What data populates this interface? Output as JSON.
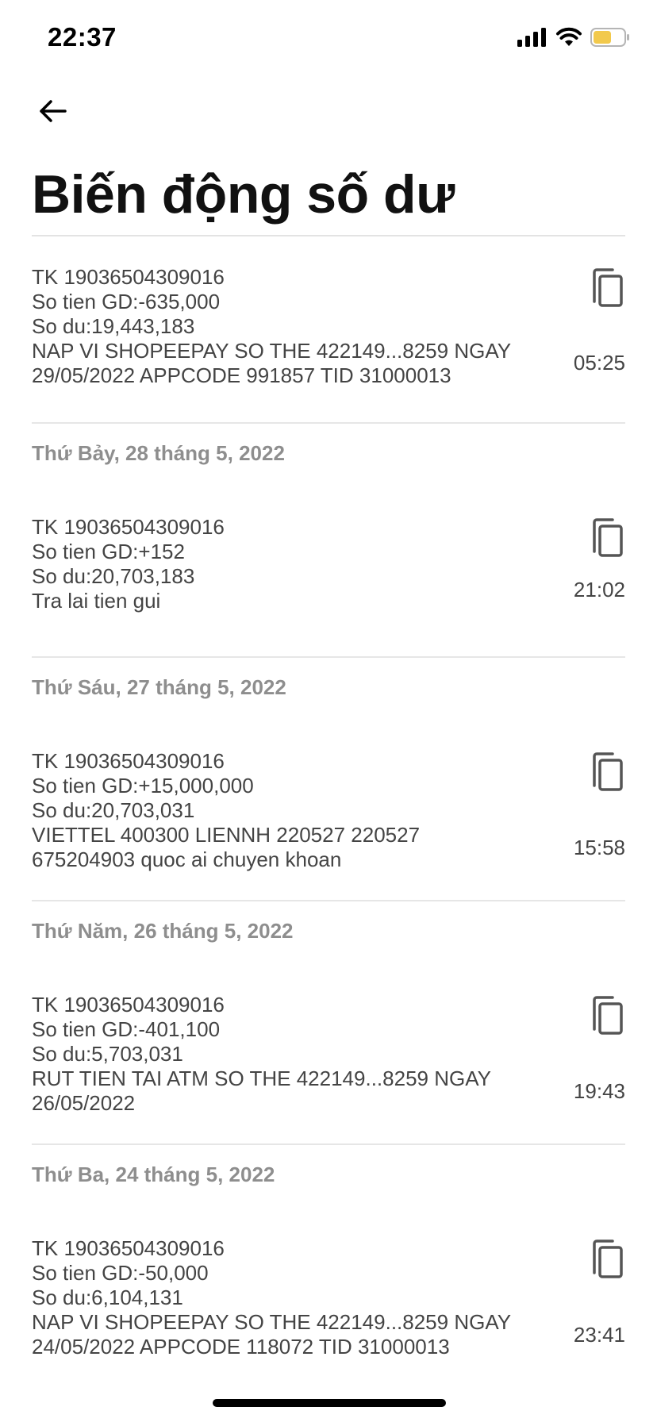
{
  "status_bar": {
    "time": "22:37",
    "battery_color": "#f2c94c"
  },
  "header": {
    "back_icon": "arrow-left-icon",
    "title": "Biến động số dư"
  },
  "groups": [
    {
      "date": "",
      "transactions": [
        {
          "account": "TK 19036504309016",
          "amount": "So tien GD:-635,000",
          "balance": "So du:19,443,183",
          "desc_line1": "NAP VI SHOPEEPAY SO THE 422149...8259 NGAY",
          "desc_line2": "29/05/2022 APPCODE 991857 TID 31000013",
          "time": "05:25"
        }
      ]
    },
    {
      "date": "Thứ Bảy, 28 tháng 5, 2022",
      "transactions": [
        {
          "account": "TK 19036504309016",
          "amount": "So tien GD:+152",
          "balance": "So du:20,703,183",
          "desc_line1": "Tra lai tien gui",
          "desc_line2": "",
          "time": "21:02"
        }
      ]
    },
    {
      "date": "Thứ Sáu, 27 tháng 5, 2022",
      "transactions": [
        {
          "account": "TK 19036504309016",
          "amount": "So tien GD:+15,000,000",
          "balance": "So du:20,703,031",
          "desc_line1": "VIETTEL 400300 LIENNH 220527 220527",
          "desc_line2": "675204903 quoc ai chuyen khoan",
          "time": "15:58"
        }
      ]
    },
    {
      "date": "Thứ Năm, 26 tháng 5, 2022",
      "transactions": [
        {
          "account": "TK 19036504309016",
          "amount": "So tien GD:-401,100",
          "balance": "So du:5,703,031",
          "desc_line1": "RUT TIEN TAI ATM SO THE 422149...8259 NGAY",
          "desc_line2": "26/05/2022",
          "time": "19:43"
        }
      ]
    },
    {
      "date": "Thứ Ba, 24 tháng 5, 2022",
      "transactions": [
        {
          "account": "TK 19036504309016",
          "amount": "So tien GD:-50,000",
          "balance": "So du:6,104,131",
          "desc_line1": "NAP VI SHOPEEPAY SO THE 422149...8259 NGAY",
          "desc_line2": "24/05/2022 APPCODE 118072 TID 31000013",
          "time": "23:41"
        }
      ]
    }
  ]
}
